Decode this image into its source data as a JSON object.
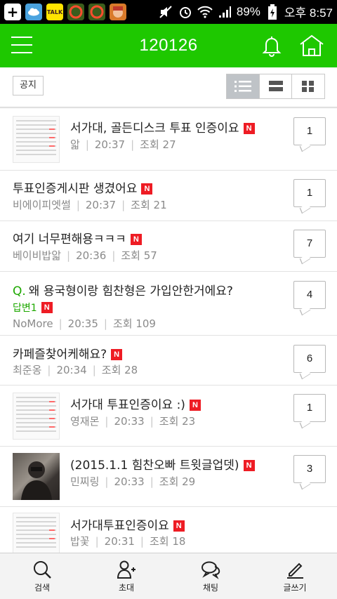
{
  "status_bar": {
    "left_icons": [
      "plus-icon",
      "cloud-icon",
      "talk-icon",
      "app-icon",
      "app-icon",
      "game-icon"
    ],
    "talk_label": "TALK",
    "battery": "89%",
    "time": "오후 8:57"
  },
  "header": {
    "title": "120126"
  },
  "toolbar": {
    "notice_label": "공지",
    "view_modes": [
      "list",
      "compact",
      "grid"
    ],
    "active_view": "list"
  },
  "new_badge": "N",
  "posts": [
    {
      "title": "서가대, 골든디스크 투표 인증이요",
      "author": "앏",
      "time": "20:37",
      "views": "조회 27",
      "comments": "1",
      "thumb": "screenshot"
    },
    {
      "title": "투표인증게시판 생겼어요",
      "author": "비에이피엣썰",
      "time": "20:37",
      "views": "조회 21",
      "comments": "1",
      "thumb": ""
    },
    {
      "title": "여기 너무편해용ㅋㅋㅋ",
      "author": "베이비밥앏",
      "time": "20:36",
      "views": "조회 57",
      "comments": "7",
      "thumb": ""
    },
    {
      "q_label": "Q.",
      "title": "왜 용국형이랑 힘찬형은 가입안한거에요?",
      "answer_label": "답변1",
      "author": "NoMore",
      "time": "20:35",
      "views": "조회 109",
      "comments": "4",
      "thumb": ""
    },
    {
      "title": "카페즐찾어케해요?",
      "author": "최준옹",
      "time": "20:34",
      "views": "조회 28",
      "comments": "6",
      "thumb": ""
    },
    {
      "title": "서가대 투표인증이요 :)",
      "author": "영재몬",
      "time": "20:33",
      "views": "조회 23",
      "comments": "1",
      "thumb": "screenshot"
    },
    {
      "title": "(2015.1.1 힘찬오빠 트윗글업뎃)",
      "author": "민찌링",
      "time": "20:33",
      "views": "조회 29",
      "comments": "3",
      "thumb": "photo"
    },
    {
      "title": "서가대투표인증이요",
      "author": "밥꽃",
      "time": "20:31",
      "views": "조회 18",
      "comments": "",
      "thumb": "screenshot"
    }
  ],
  "bottom_nav": [
    {
      "label": "검색",
      "icon": "search-icon"
    },
    {
      "label": "초대",
      "icon": "invite-user-icon"
    },
    {
      "label": "채팅",
      "icon": "chat-icon"
    },
    {
      "label": "글쓰기",
      "icon": "write-icon"
    }
  ],
  "colors": {
    "brand_green": "#1ec800",
    "new_badge_red": "#ee1c24",
    "question_green": "#1ea800"
  }
}
